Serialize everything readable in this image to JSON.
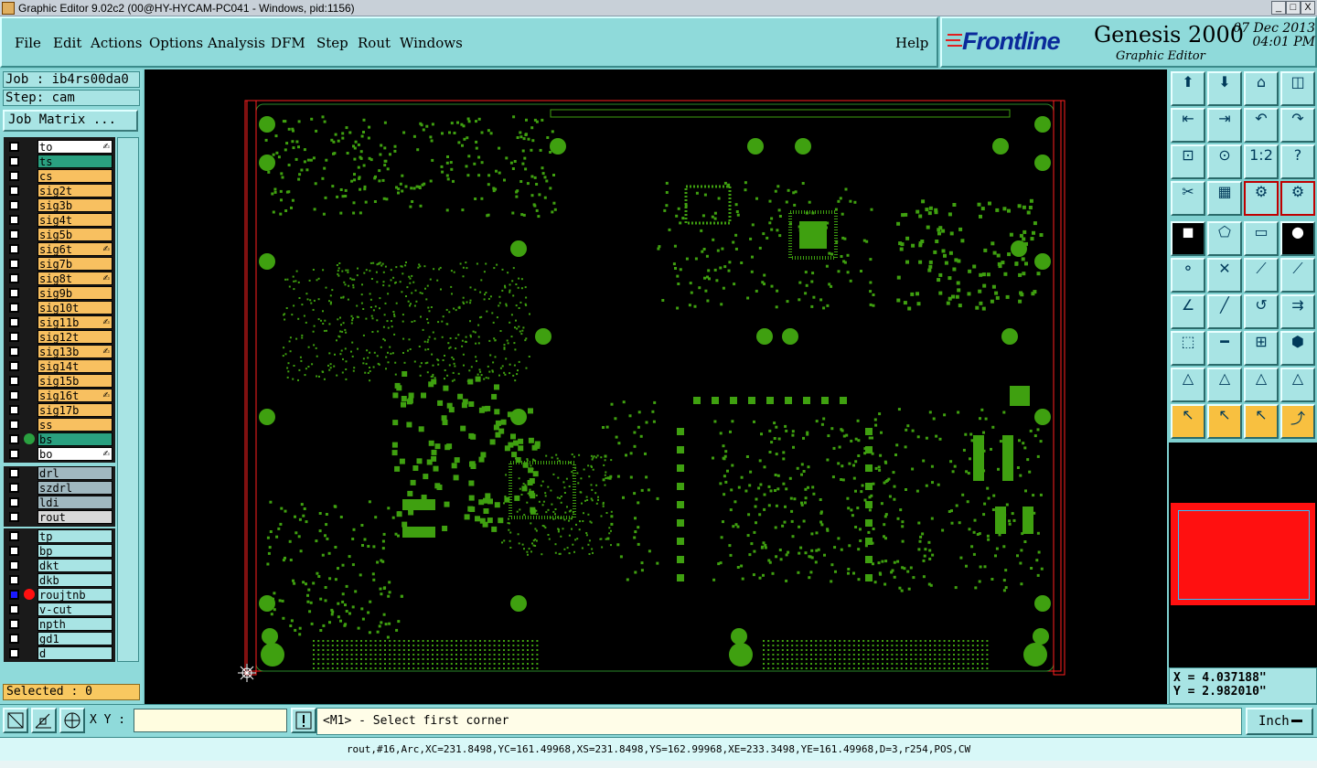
{
  "window": {
    "title": "Graphic Editor 9.02c2 (00@HY-HYCAM-PC041 - Windows, pid:1156)",
    "buttons": [
      "_",
      "□",
      "X"
    ]
  },
  "menu": {
    "items": [
      "File",
      "Edit",
      "Actions",
      "Options",
      "Analysis",
      "DFM",
      "Step",
      "Rout",
      "Windows"
    ],
    "help": "Help"
  },
  "brand": {
    "logo": "Frontline",
    "product": "Genesis 2000",
    "subtitle": "Graphic Editor",
    "date": "07 Dec 2013",
    "time": "04:01 PM"
  },
  "job": {
    "job_line": "Job : ib4rs00da0",
    "step_line": "Step: cam",
    "matrix_button": "Job Matrix ..."
  },
  "layers": [
    {
      "name": "to",
      "color": "#ffffff",
      "editable": true
    },
    {
      "name": "ts",
      "color": "#2aa080",
      "editable": false
    },
    {
      "name": "cs",
      "color": "#f8c060",
      "editable": false
    },
    {
      "name": "sig2t",
      "color": "#f8c060",
      "editable": false
    },
    {
      "name": "sig3b",
      "color": "#f8c060",
      "editable": false
    },
    {
      "name": "sig4t",
      "color": "#f8c060",
      "editable": false
    },
    {
      "name": "sig5b",
      "color": "#f8c060",
      "editable": false
    },
    {
      "name": "sig6t",
      "color": "#f8c060",
      "editable": true
    },
    {
      "name": "sig7b",
      "color": "#f8c060",
      "editable": false
    },
    {
      "name": "sig8t",
      "color": "#f8c060",
      "editable": true
    },
    {
      "name": "sig9b",
      "color": "#f8c060",
      "editable": false
    },
    {
      "name": "sig10t",
      "color": "#f8c060",
      "editable": false
    },
    {
      "name": "sig11b",
      "color": "#f8c060",
      "editable": true
    },
    {
      "name": "sig12t",
      "color": "#f8c060",
      "editable": false
    },
    {
      "name": "sig13b",
      "color": "#f8c060",
      "editable": true
    },
    {
      "name": "sig14t",
      "color": "#f8c060",
      "editable": false
    },
    {
      "name": "sig15b",
      "color": "#f8c060",
      "editable": false
    },
    {
      "name": "sig16t",
      "color": "#f8c060",
      "editable": true
    },
    {
      "name": "sig17b",
      "color": "#f8c060",
      "editable": false
    },
    {
      "name": "ss",
      "color": "#f8c060",
      "editable": false
    },
    {
      "name": "bs",
      "color": "#2aa080",
      "editable": false,
      "dot": "#2aa040"
    },
    {
      "name": "bo",
      "color": "#ffffff",
      "editable": true
    },
    {
      "name": "drl",
      "color": "#a0b8c0",
      "editable": false
    },
    {
      "name": "szdrl",
      "color": "#a0b8c0",
      "editable": false
    },
    {
      "name": "ldi",
      "color": "#a0b8c0",
      "editable": false
    },
    {
      "name": "rout",
      "color": "#d8d8d8",
      "editable": false
    },
    {
      "name": "tp",
      "color": "#a8e4e4",
      "editable": false
    },
    {
      "name": "bp",
      "color": "#a8e4e4",
      "editable": false
    },
    {
      "name": "dkt",
      "color": "#a8e4e4",
      "editable": false
    },
    {
      "name": "dkb",
      "color": "#a8e4e4",
      "editable": false
    },
    {
      "name": "roujtnb",
      "color": "#a8e4e4",
      "editable": false,
      "dot": "#ff1010",
      "work": true
    },
    {
      "name": "v-cut",
      "color": "#a8e4e4",
      "editable": false
    },
    {
      "name": "npth",
      "color": "#a8e4e4",
      "editable": false
    },
    {
      "name": "gd1",
      "color": "#a8e4e4",
      "editable": false
    },
    {
      "name": "d",
      "color": "#a8e4e4",
      "editable": false
    }
  ],
  "selected": "Selected : 0",
  "coords": {
    "x": "X = 4.037188\"",
    "y": "Y = 2.982010\""
  },
  "bottom": {
    "xy_label": "X Y :",
    "xy_value": "",
    "prompt": "<M1> - Select first corner",
    "unit": "Inch"
  },
  "status": "rout,#16,Arc,XC=231.8498,YC=161.49968,XS=231.8498,YS=162.99968,XE=233.3498,YE=161.49968,D=3,r254,POS,CW",
  "colors": {
    "pcb_feature": "#3fa010",
    "outline": "#ff2020",
    "profile": "#2a8a2a",
    "panel_bg": "#8fdada"
  }
}
